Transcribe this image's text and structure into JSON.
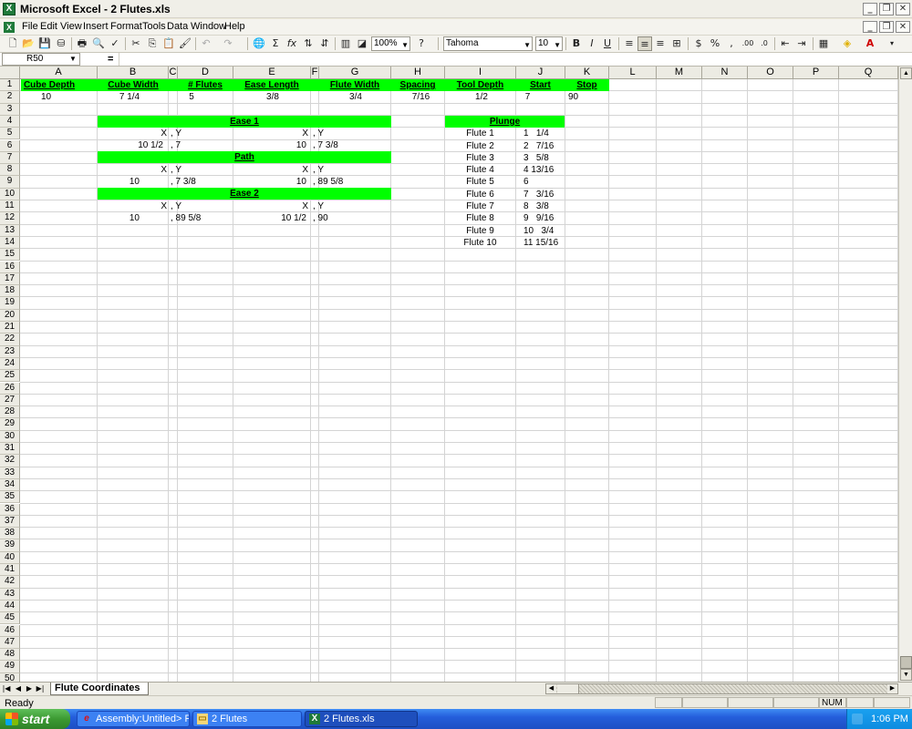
{
  "window": {
    "title": "Microsoft Excel - 2 Flutes.xls",
    "app_icon": "X"
  },
  "menu": [
    {
      "label": "File",
      "u": "F",
      "rest": "ile"
    },
    {
      "label": "Edit",
      "u": "E",
      "rest": "dit"
    },
    {
      "label": "View",
      "u": "V",
      "rest": "iew"
    },
    {
      "label": "Insert",
      "u": "I",
      "rest": "nsert"
    },
    {
      "label": "Format",
      "u": "F",
      "rest": "ormat",
      "prefix": "",
      "underline_index": 1
    },
    {
      "label": "Tools",
      "u": "T",
      "rest": "ools"
    },
    {
      "label": "Data",
      "u": "D",
      "rest": "ata"
    },
    {
      "label": "Window",
      "u": "W",
      "rest": "indow"
    },
    {
      "label": "Help",
      "u": "H",
      "rest": "elp"
    }
  ],
  "toolbar": {
    "zoom": "100%",
    "font": "Tahoma",
    "size": "10"
  },
  "formula": {
    "namebox": "R50",
    "fx": "="
  },
  "columns": [
    "A",
    "B",
    "C",
    "D",
    "E",
    "F",
    "G",
    "H",
    "I",
    "J",
    "K",
    "L",
    "M",
    "N",
    "O",
    "P",
    "Q"
  ],
  "rows": [
    "1",
    "2",
    "3",
    "4",
    "5",
    "6",
    "7",
    "8",
    "9",
    "10",
    "11",
    "12",
    "13",
    "14",
    "15",
    "16",
    "17",
    "18",
    "19",
    "20",
    "21",
    "22",
    "23",
    "24",
    "25",
    "26",
    "27",
    "28",
    "29",
    "30",
    "31",
    "32",
    "33",
    "34",
    "35",
    "36",
    "37",
    "38",
    "39",
    "40",
    "41",
    "42",
    "43",
    "44",
    "45",
    "46",
    "47",
    "48",
    "49",
    "50"
  ],
  "sheet": {
    "headers": [
      "Cube Depth",
      "Cube Width",
      "# Flutes",
      "Ease Length",
      "Flute Width",
      "Spacing",
      "Tool Depth",
      "Start",
      "Stop"
    ],
    "values": [
      "10",
      "7  1/4",
      "5",
      "3/8",
      "3/4",
      "7/16",
      "1/2",
      "7",
      "90"
    ],
    "ease1": {
      "title": "Ease 1",
      "x": "X",
      "y": ", Y",
      "x2": "X",
      "y2": ", Y",
      "v1": "10   1/2",
      "v2": ", 7",
      "v3": "10",
      "v4": ", 7   3/8"
    },
    "path": {
      "title": "Path",
      "x": "X",
      "y": ", Y",
      "x2": "X",
      "y2": ", Y",
      "v1": "10",
      "v2": ", 7   3/8",
      "v3": "10",
      "v4": ", 89   5/8"
    },
    "ease2": {
      "title": "Ease 2",
      "x": "X",
      "y": ", Y",
      "x2": "X",
      "y2": ", Y",
      "v1": "10",
      "v2": ", 89   5/8",
      "v3": "10   1/2",
      "v4": ", 90"
    },
    "plunge": {
      "title": "Plunge",
      "flutes": [
        "Flute 1",
        "Flute 2",
        "Flute 3",
        "Flute 4",
        "Flute 5",
        "Flute 6",
        "Flute 7",
        "Flute 8",
        "Flute 9",
        "Flute 10"
      ],
      "starts": [
        "1   1/4",
        "2   7/16",
        "3   5/8",
        "4 13/16",
        "6",
        "7   3/16",
        "8   3/8",
        "9   9/16",
        "10   3/4",
        "11 15/16"
      ]
    }
  },
  "tabs": {
    "sheet": "Flute Coordinates"
  },
  "status": {
    "text": "Ready",
    "num": "NUM"
  },
  "taskbar": {
    "start": "start",
    "tasks": [
      "Assembly:Untitled> P...",
      "2 Flutes",
      "2 Flutes.xls"
    ],
    "clock": "1:06 PM"
  },
  "colors": {
    "accent_green": "#00ff00",
    "taskbar_blue": "#245edb"
  }
}
